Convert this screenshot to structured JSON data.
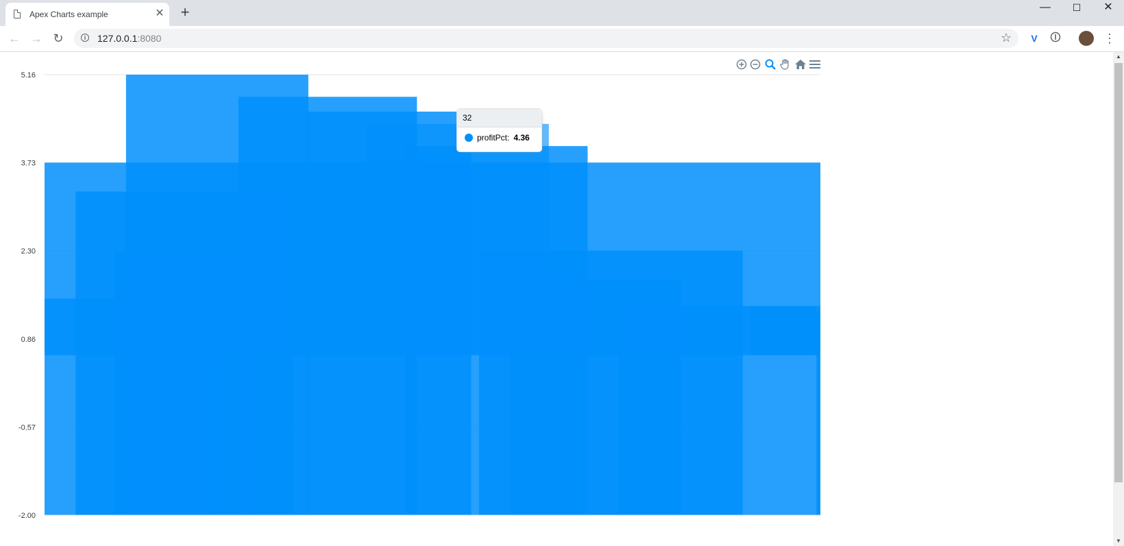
{
  "browser": {
    "tab_title": "Apex Charts example",
    "tab_close": "✕",
    "new_tab": "+",
    "url_host": "127.0.0.1",
    "url_port": ":8080",
    "win_minimize": "—",
    "win_maximize": "☐",
    "win_close": "✕"
  },
  "chart_toolbar": {
    "icons": [
      "zoom-in-icon",
      "zoom-out-icon",
      "selection-zoom-icon",
      "pan-icon",
      "reset-zoom-icon",
      "menu-icon"
    ]
  },
  "tooltip": {
    "title": "32",
    "series_name": "profitPct:",
    "value": "4.36",
    "marker_color": "#008FFB"
  },
  "chart_data": {
    "type": "area",
    "series_name": "profitPct",
    "y_ticks": [
      "5.16",
      "3.73",
      "2.30",
      "0.86",
      "-0.57",
      "-2.00"
    ],
    "ylim": [
      -2.0,
      5.16
    ],
    "color": "#008FFB",
    "grid": true,
    "blocks": [
      {
        "x": [
          0,
          1.0
        ],
        "top": 3.73,
        "bottom": 0.6
      },
      {
        "x": [
          0.09,
          0.27
        ],
        "top": 2.3,
        "bottom": -2.0
      },
      {
        "x": [
          0.04,
          0.32
        ],
        "top": 3.26,
        "bottom": -2.0
      },
      {
        "x": [
          0.0,
          0.22
        ],
        "top": 1.52,
        "bottom": -2.0
      },
      {
        "x": [
          0.105,
          0.34
        ],
        "top": 5.16,
        "bottom": -2.0
      },
      {
        "x": [
          0.25,
          0.48
        ],
        "top": 4.8,
        "bottom": -2.0
      },
      {
        "x": [
          0.338,
          0.55
        ],
        "top": 4.56,
        "bottom": -2.0
      },
      {
        "x": [
          0.415,
          0.65
        ],
        "top": 4.36,
        "bottom": 0.6
      },
      {
        "x": [
          0.465,
          0.7
        ],
        "top": 4.0,
        "bottom": -2.0
      },
      {
        "x": [
          0.56,
          0.9
        ],
        "top": 2.3,
        "bottom": -2.0
      },
      {
        "x": [
          0.6,
          0.82
        ],
        "top": 1.83,
        "bottom": -2.0
      },
      {
        "x": [
          0.74,
          1.0
        ],
        "top": 1.4,
        "bottom": -2.0
      },
      {
        "x": [
          0.91,
          0.995
        ],
        "top": 1.4,
        "bottom": 0.6
      },
      {
        "x": [
          0.995,
          1.0
        ],
        "top": 1.3,
        "bottom": -2.0
      }
    ]
  }
}
